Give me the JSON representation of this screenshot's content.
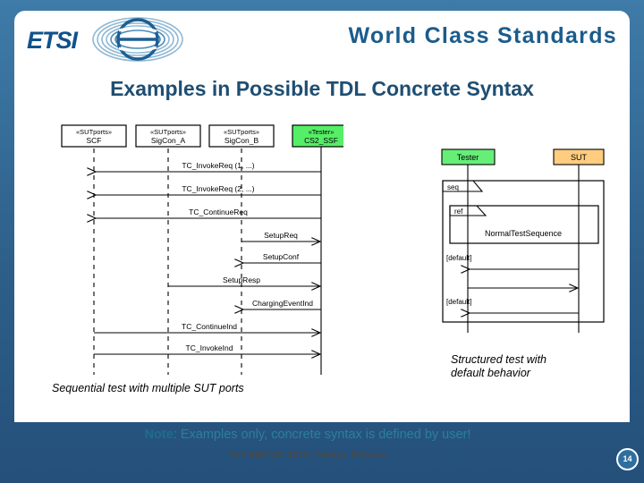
{
  "header": {
    "logo_text": "ETSI",
    "logo_icon": "etsi-swirl-logo",
    "tagline": "World Class Standards"
  },
  "title": "Examples in Possible TDL Concrete Syntax",
  "left_diagram": {
    "caption": "Sequential test with multiple SUT ports",
    "lifelines": [
      {
        "stereotype": "«SUTports»",
        "name": "SCF",
        "fill": "#ffffff"
      },
      {
        "stereotype": "«SUTports»",
        "name": "SigCon_A",
        "fill": "#ffffff"
      },
      {
        "stereotype": "«SUTports»",
        "name": "SigCon_B",
        "fill": "#ffffff"
      },
      {
        "stereotype": "«Tester»",
        "name": "CS2_SSF",
        "fill": "#55ee66"
      }
    ],
    "messages": [
      {
        "label": "TC_InvokeReq (1, ...)",
        "from": 3,
        "to": 0,
        "dir": "left"
      },
      {
        "label": "TC_InvokeReq (2, ...)",
        "from": 3,
        "to": 0,
        "dir": "left"
      },
      {
        "label": "TC_ContinueReq",
        "from": 3,
        "to": 0,
        "dir": "left"
      },
      {
        "label": "SetupReq",
        "from": 2,
        "to": 3,
        "dir": "right"
      },
      {
        "label": "SetupConf",
        "from": 3,
        "to": 2,
        "dir": "left"
      },
      {
        "label": "SetupResp",
        "from": 1,
        "to": 3,
        "dir": "right"
      },
      {
        "label": "ChargingEventInd",
        "from": 3,
        "to": 2,
        "dir": "left"
      },
      {
        "label": "TC_ContinueInd",
        "from": 0,
        "to": 3,
        "dir": "right"
      },
      {
        "label": "TC_InvokeInd",
        "from": 0,
        "to": 3,
        "dir": "right"
      }
    ]
  },
  "right_diagram": {
    "caption_line1": "Structured test with",
    "caption_line2": "default behavior",
    "lifelines": [
      {
        "name": "Tester",
        "fill": "#66ee77"
      },
      {
        "name": "SUT",
        "fill": "#ffcc80"
      }
    ],
    "fragments": [
      {
        "kind": "seq",
        "label": "seq"
      },
      {
        "kind": "ref",
        "label": "ref",
        "body": "NormalTestSequence"
      }
    ],
    "guards": [
      {
        "label": "[default]"
      },
      {
        "label": "[default]"
      }
    ]
  },
  "note": {
    "prefix": "Note",
    "text": ": Examples only, concrete syntax is defined by user!"
  },
  "conference": "2nd MBTUC 2012, Tallinn, Estonia",
  "page_number": "14",
  "colors": {
    "background": "#2d5f8a",
    "title": "#1f4e72",
    "note": "#2b7f9e",
    "tester_green": "#55ee66",
    "sut_orange": "#ffcc80"
  }
}
